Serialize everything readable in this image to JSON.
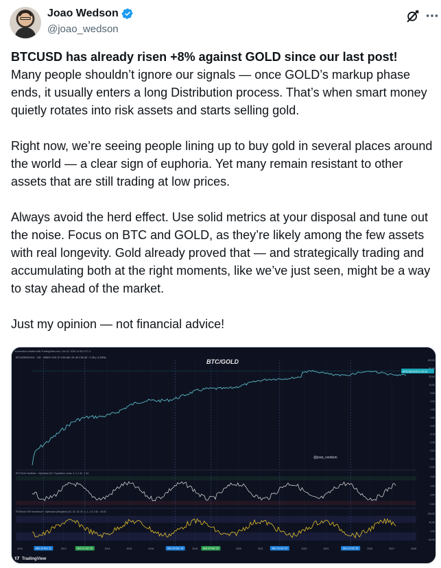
{
  "tweet": {
    "author": {
      "display_name": "Joao Wedson",
      "handle": "@joao_wedson",
      "verified": true
    },
    "headline": "BTCUSD has already risen +8% against GOLD since our last post!",
    "paragraphs": [
      "Many people shouldn’t ignore our signals — once GOLD’s markup phase ends, it usually enters a long Distribution process. That’s when smart money quietly rotates into risk assets and starts selling gold.",
      "Right now, we’re seeing people lining up to buy gold in several places around the world — a clear sign of euphoria. Yet many remain resistant to other assets that are still trading at low prices.",
      "Always avoid the herd effect. Use solid metrics at your disposal and tune out the noise. Focus on BTC and GOLD, as they’re likely among the few assets with real longevity. Gold already proved that — and strategically trading and accumulating both at the right moments, like we’ve just seen, might be a way to stay ahead of the market.",
      "Just my opinion — not financial advice!"
    ]
  },
  "icons": {
    "grok": "grok-icon",
    "more": "more-icon",
    "verified": "verified-badge-icon"
  },
  "colors": {
    "verified": "#1d9bf0",
    "chart_bg": "#0e1220",
    "gold_line": "#e6c229",
    "price_line": "#5ab9c9",
    "white_line": "#e8e8e8"
  },
  "chart": {
    "header_text": "Screenshot created with TradingView.com, Oct 22, 2025 14:36 UTC-3",
    "symbol_line": "BTCUSD/GOLD · 1W · INDEX  O31.37 H31.68 L31.49 C30.45 −1.35 (−4.25%)",
    "title": "BTC/GOLD",
    "watermark": "@joao_wedson",
    "price_tag": "BTCUSD/GOLD 30.33",
    "osc1_label": "BTC/Gold Oscillator · Alphractal (52, Population, close, 3, 2, 1.8) · 1.40",
    "osc2_label": "RSI/Stoch-RSI Momentum · Alphractal (Weighted) (52, 52, 52, 52, 1, 1, 1.5, 0.8) · 45.82",
    "price_axis": [
      "100.00",
      "50.00",
      "20.00",
      "10.00",
      "5.00",
      "2.00",
      "1.00",
      "0.50",
      "0.20",
      "0.10",
      "0.05",
      "0.02",
      "0.01",
      "−0.00"
    ],
    "osc1_axis": [
      "4.00",
      "2.00",
      "0.00",
      "−2.00"
    ],
    "osc2_axis": [
      "100.00",
      "40.00",
      "0.00",
      "−40.00"
    ],
    "years": [
      "2010",
      "2011",
      "2012",
      "2013",
      "2014",
      "2015",
      "2016",
      "2017",
      "2018",
      "2019",
      "2020",
      "2021",
      "2022",
      "2023",
      "2024",
      "2025",
      "2026",
      "2027",
      "2028"
    ],
    "date_badges": [
      {
        "text": "Mon 14 Nov '11",
        "color": "#1e7fd9"
      },
      {
        "text": "Mon 12 Jan '15",
        "color": "#2e9e4f"
      },
      {
        "text": "Mon 10 Dec '18",
        "color": "#1e7fd9"
      },
      {
        "text": "Mon 09 Mar '20",
        "color": "#2e9e4f"
      },
      {
        "text": "Mon 15 Jun '22",
        "color": "#1e7fd9"
      },
      {
        "text": "Mon 13 Oct '25",
        "color": "#1e7fd9"
      }
    ],
    "footer_brand": "TradingView"
  }
}
